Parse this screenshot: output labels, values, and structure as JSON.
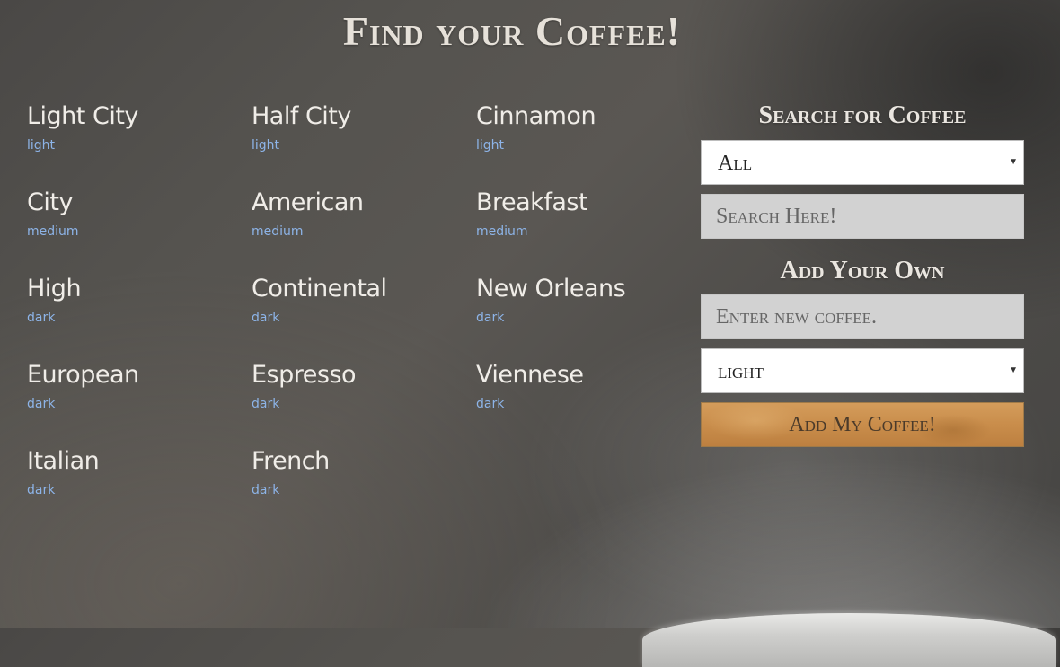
{
  "header": {
    "title": "Find your Coffee!"
  },
  "coffees": [
    {
      "name": "Light City",
      "roast": "light"
    },
    {
      "name": "Half City",
      "roast": "light"
    },
    {
      "name": "Cinnamon",
      "roast": "light"
    },
    {
      "name": "City",
      "roast": "medium"
    },
    {
      "name": "American",
      "roast": "medium"
    },
    {
      "name": "Breakfast",
      "roast": "medium"
    },
    {
      "name": "High",
      "roast": "dark"
    },
    {
      "name": "Continental",
      "roast": "dark"
    },
    {
      "name": "New Orleans",
      "roast": "dark"
    },
    {
      "name": "European",
      "roast": "dark"
    },
    {
      "name": "Espresso",
      "roast": "dark"
    },
    {
      "name": "Viennese",
      "roast": "dark"
    },
    {
      "name": "Italian",
      "roast": "dark"
    },
    {
      "name": "French",
      "roast": "dark"
    }
  ],
  "search": {
    "heading": "Search for Coffee",
    "roast_select_value": "All",
    "input_placeholder": "Search Here!"
  },
  "add": {
    "heading": "Add Your Own",
    "input_placeholder": "Enter new coffee.",
    "roast_select_value": "light",
    "button_label": "Add My Coffee!"
  },
  "colors": {
    "coffee_name": "#f0ede8",
    "roast_label": "#8db4e8",
    "button_accent": "#c98d4b"
  }
}
